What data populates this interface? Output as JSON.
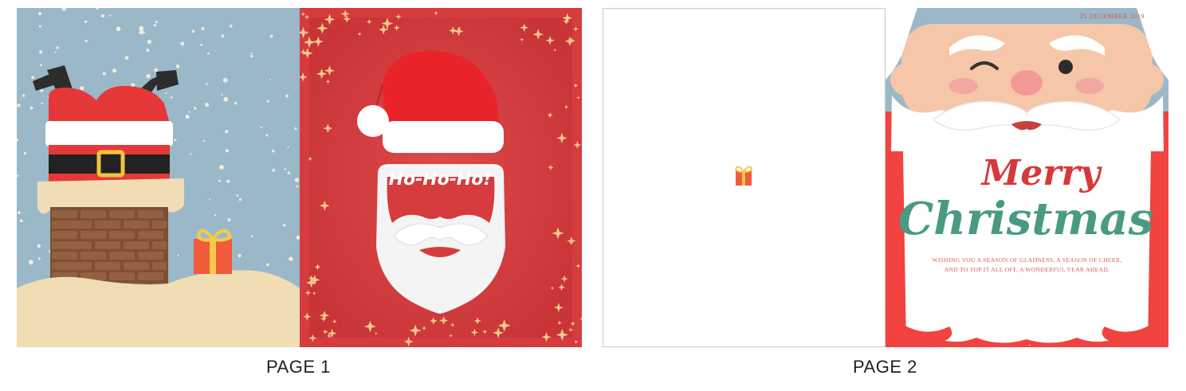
{
  "pages": [
    {
      "caption": "PAGE 1"
    },
    {
      "caption": "PAGE 2"
    }
  ],
  "page1": {
    "badge_text": "Ho-Ho-Ho!"
  },
  "page2": {
    "date": "25 DECEMBER 2019",
    "title_line1": "Merry",
    "title_line2": "Christmas",
    "message_line1": "WISHING YOU A SEASON OF GLADNESS, A SEASON OF CHEER,",
    "message_line2": "AND TO TOP IT ALL OFF, A WONDERFUL YEAR AHEAD."
  },
  "colors": {
    "sky": "#9bb8c9",
    "card_red": "#d63b3e",
    "santa_red": "#ee3d3a",
    "snow": "#f0ddb4",
    "brick": "#8b5a3f",
    "gold": "#f4cf64",
    "title_red": "#d5393a",
    "title_green": "#4a9a83"
  },
  "icons": [
    "gift-icon",
    "snowflake-icon",
    "santa-hat-icon",
    "belt-buckle-icon"
  ]
}
